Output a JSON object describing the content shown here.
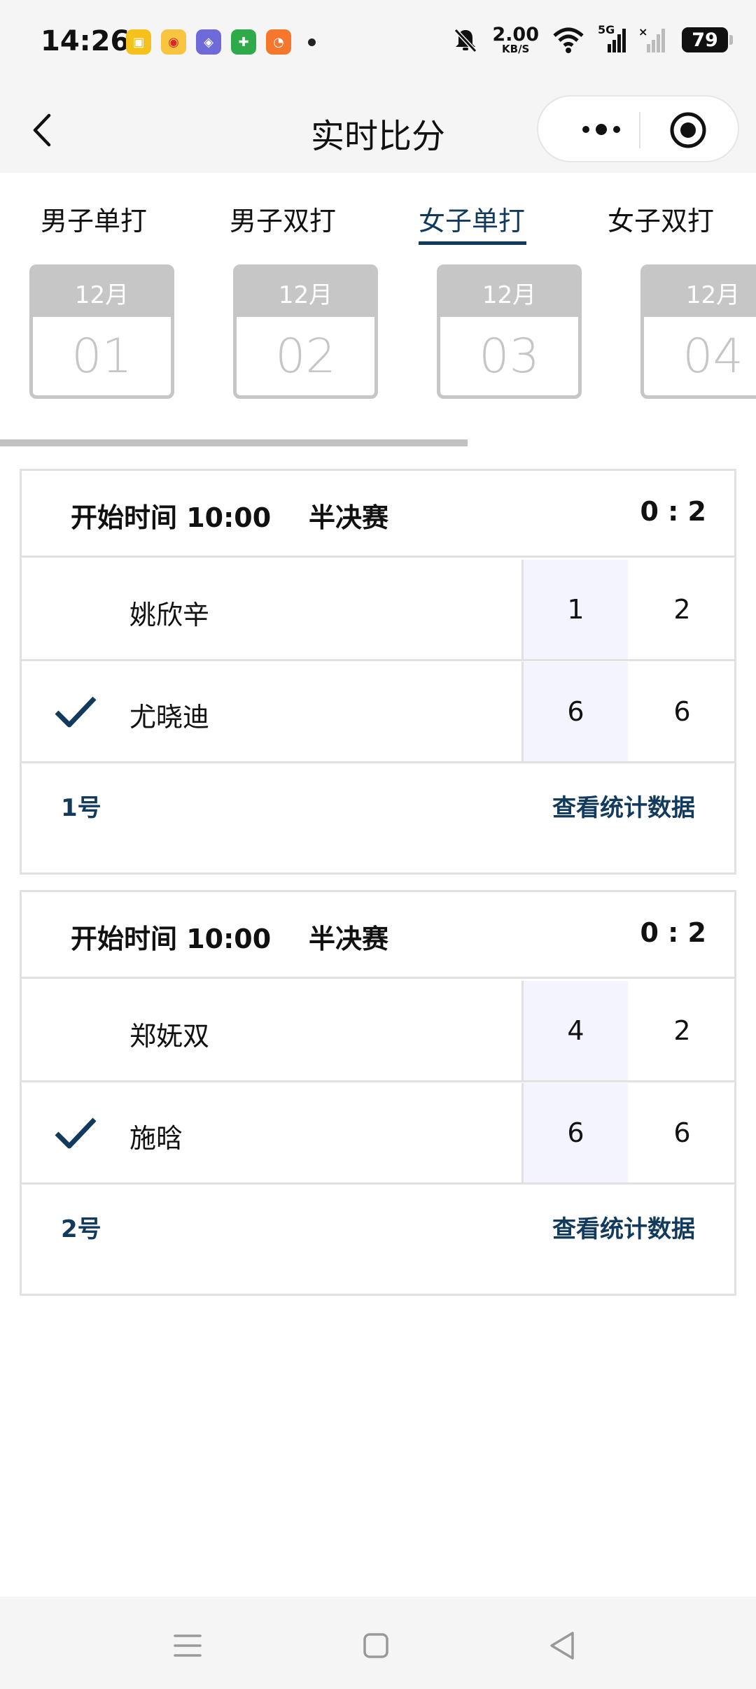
{
  "status_bar": {
    "time": "14:26",
    "apps": [
      {
        "icon": "app-icon-yellow",
        "glyph": "📷",
        "color": "#f4c21b"
      },
      {
        "icon": "weibo-icon",
        "glyph": "微",
        "color": "#f7c540"
      },
      {
        "icon": "tieba-icon",
        "glyph": "贴",
        "color": "#6e6bd8"
      },
      {
        "icon": "pupu-icon",
        "glyph": "朴",
        "color": "#2faa4b"
      },
      {
        "icon": "app-icon-orange",
        "glyph": "◔",
        "color": "#f4772b"
      }
    ],
    "net_speed_value": "2.00",
    "net_speed_unit": "KB/S",
    "signal_label": "5G",
    "battery": "79"
  },
  "header": {
    "title": "实时比分"
  },
  "tabs": [
    {
      "label": "男子单打",
      "active": false
    },
    {
      "label": "男子双打",
      "active": false
    },
    {
      "label": "女子单打",
      "active": true
    },
    {
      "label": "女子双打",
      "active": false
    }
  ],
  "dates": [
    {
      "month": "12月",
      "day": "01"
    },
    {
      "month": "12月",
      "day": "02"
    },
    {
      "month": "12月",
      "day": "03"
    },
    {
      "month": "12月",
      "day": "04"
    }
  ],
  "matches": [
    {
      "start_time": "开始时间 10:00",
      "round": "半决赛",
      "score": "0 : 2",
      "players": [
        {
          "name": "姚欣辛",
          "winner": false,
          "set1": "1",
          "set2": "2"
        },
        {
          "name": "尤晓迪",
          "winner": true,
          "set1": "6",
          "set2": "6"
        }
      ],
      "court": "1号",
      "stats_link": "查看统计数据"
    },
    {
      "start_time": "开始时间 10:00",
      "round": "半决赛",
      "score": "0 : 2",
      "players": [
        {
          "name": "郑妩双",
          "winner": false,
          "set1": "4",
          "set2": "2"
        },
        {
          "name": "施晗",
          "winner": true,
          "set1": "6",
          "set2": "6"
        }
      ],
      "court": "2号",
      "stats_link": "查看统计数据"
    }
  ],
  "colors": {
    "accent": "#123a5c",
    "set_highlight": "#f3f4fd",
    "date_gray": "#c6c6c6"
  }
}
